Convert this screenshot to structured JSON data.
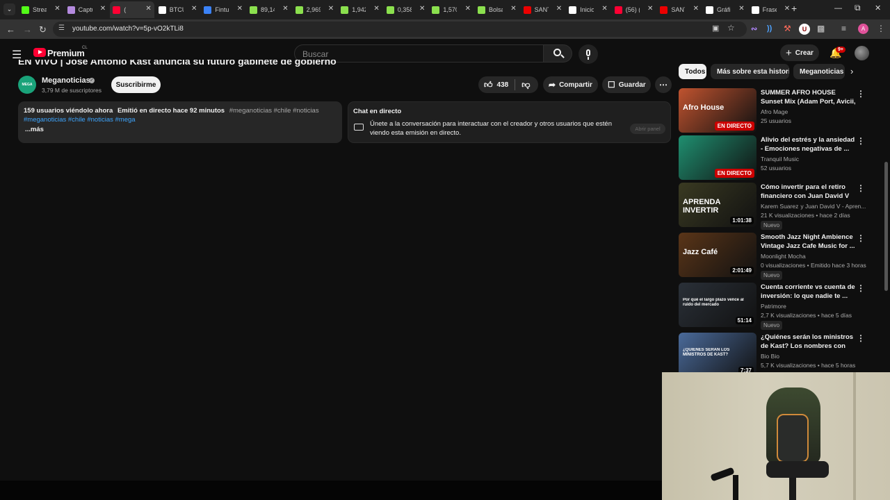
{
  "browser": {
    "tabs": [
      {
        "title": "Strea",
        "icon": "kick-icon",
        "color": "#53fc18"
      },
      {
        "title": "Captu",
        "icon": "pen-icon",
        "color": "#b48ade"
      },
      {
        "title": "(",
        "icon": "youtube-icon",
        "color": "#ff0033"
      },
      {
        "title": "BTCU",
        "icon": "tradingview-icon",
        "color": "#ffffff"
      },
      {
        "title": "Fintu",
        "icon": "fintual-icon",
        "color": "#3b82f6"
      },
      {
        "title": "89,14",
        "icon": "leaf-icon",
        "color": "#8be04e"
      },
      {
        "title": "2,969",
        "icon": "leaf-icon",
        "color": "#8be04e"
      },
      {
        "title": "1,942",
        "icon": "leaf-icon",
        "color": "#8be04e"
      },
      {
        "title": "0,358",
        "icon": "leaf-icon",
        "color": "#8be04e"
      },
      {
        "title": "1,570",
        "icon": "leaf-icon",
        "color": "#8be04e"
      },
      {
        "title": "Bolsa",
        "icon": "leaf-icon",
        "color": "#8be04e"
      },
      {
        "title": "SANT",
        "icon": "santander-icon",
        "color": "#ec0000"
      },
      {
        "title": "Inicio",
        "icon": "x-icon",
        "color": "#ffffff"
      },
      {
        "title": "(56) (",
        "icon": "youtube-icon",
        "color": "#ff0033"
      },
      {
        "title": "SANT",
        "icon": "santander-icon",
        "color": "#ec0000"
      },
      {
        "title": "Gráfi",
        "icon": "tradingview-icon",
        "color": "#ffffff"
      },
      {
        "title": "Frase",
        "icon": "bold-b-icon",
        "color": "#ffffff"
      }
    ],
    "url": "youtube.com/watch?v=5p-vO2kTLi8"
  },
  "youtube": {
    "logo_text": "Premium",
    "region": "CL",
    "search_placeholder": "Buscar",
    "create_label": "Crear",
    "notif_count": "9+"
  },
  "video": {
    "title": "EN VIVO | José Antonio Kast anuncia su futuro gabinete de gobierno",
    "channel": "Meganoticias",
    "subscribers": "3,79 M de suscriptores",
    "subscribe_label": "Suscribirme",
    "likes": "438",
    "share_label": "Compartir",
    "save_label": "Guardar",
    "description": {
      "viewers": "159 usuarios viéndolo ahora",
      "streamed": "Emitió en directo hace 92 minutos",
      "tags_line1": "#meganoticias #chile #noticias",
      "tags_line2": "#meganoticias #chile #noticias #mega",
      "more": "...más"
    },
    "chat": {
      "title": "Chat en directo",
      "message": "Únete a la conversación para interactuar con el creador y otros usuarios que estén viendo esta emisión en directo.",
      "open_label": "Abrir panel"
    }
  },
  "chips": [
    "Todos",
    "Más sobre esta historia",
    "Meganoticias"
  ],
  "recommendations": [
    {
      "title": "SUMMER AFRO HOUSE Sunset Mix (Adam Port, Avicii, The ...",
      "channel": "Afro Mage",
      "meta": "25 usuarios",
      "badge": "EN DIRECTO",
      "thumb_text": "Afro House",
      "thumb_color": "#c0532f"
    },
    {
      "title": "Alivio del estrés y la ansiedad - Emociones negativas de ...",
      "channel": "Tranquil Music",
      "meta": "52 usuarios",
      "badge": "EN DIRECTO",
      "thumb_text": "",
      "thumb_color": "#1f8f70"
    },
    {
      "title": "Cómo invertir para el retiro financiero con Juan David V d...",
      "channel": "Karem Suarez",
      "channel_extra": "y Juan David V - Apren...",
      "meta": "21 K visualizaciones • hace 2 días",
      "badge": "1:01:38",
      "tag": "Nuevo",
      "thumb_text": "APRENDA INVERTIR",
      "thumb_color": "#3a3a22"
    },
    {
      "title": "Smooth Jazz Night Ambience Vintage Jazz Cafe Music for ...",
      "channel": "Moonlight Mocha",
      "meta": "0 visualizaciones • Emitido hace 3 horas",
      "badge": "2:01:49",
      "tag": "Nuevo",
      "thumb_text": "Jazz Café",
      "thumb_color": "#5a3518"
    },
    {
      "title": "Cuenta corriente vs cuenta de inversión: lo que nadie te ...",
      "channel": "Patrimore",
      "meta": "2,7 K visualizaciones • hace 5 días",
      "badge": "51:14",
      "tag": "Nuevo",
      "thumb_text": "Por qué el largo plazo vence al ruido del mercado",
      "thumb_color": "#2a3038"
    },
    {
      "title": "¿Quiénes serán los ministros de Kast? Los nombres con más ...",
      "channel": "Bio Bio",
      "meta": "5,7 K visualizaciones • hace 5 horas",
      "badge": "7:37",
      "thumb_text": "¿QUIÉNES SERÁN LOS MINISTROS DE KAST?",
      "thumb_color": "#4a6a9a"
    }
  ],
  "colors": {
    "accent": "#ff0033",
    "live": "#cc0000",
    "bg": "#0f0f0f"
  }
}
